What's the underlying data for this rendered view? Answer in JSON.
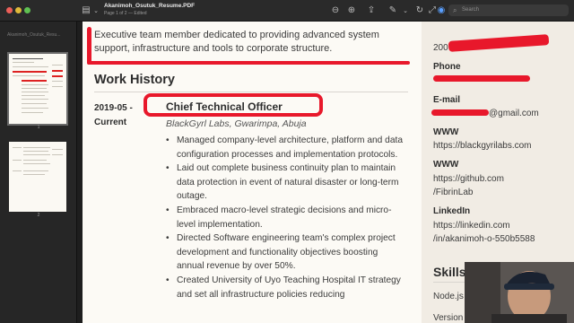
{
  "window": {
    "title": "Akanimoh_Osutuk_Resume.PDF",
    "subtitle": "Page 1 of 2 — Edited",
    "search_placeholder": "Search"
  },
  "sidebar": {
    "document_name": "Akanimoh_Osutuk_Resu...",
    "pages": [
      {
        "label": "1"
      },
      {
        "label": "2"
      }
    ]
  },
  "resume": {
    "summary_line1": "Executive team member dedicated to providing advanced system",
    "summary_line2": "support, infrastructure and tools to corporate structure.",
    "work_history_heading": "Work History",
    "job": {
      "dates_line1": "2019-05 -",
      "dates_line2": "Current",
      "title": "Chief Technical Officer",
      "company": "BlackGyrl Labs, Gwarimpa, Abuja",
      "bullets": [
        "Managed company-level architecture, platform and data configuration processes and implementation protocols.",
        "Laid out complete business continuity plan to maintain data protection in event of natural disaster or long-term outage.",
        "Embraced macro-level strategic decisions and micro-level implementation.",
        "Directed Software engineering team's complex project development and functionality objectives boosting annual revenue by over 50%.",
        "Created University of Uyo Teaching Hospital IT strategy and set all infrastructure policies reducing"
      ]
    }
  },
  "contact": {
    "year_fragment": "200",
    "phone_label": "Phone",
    "email_label": "E-mail",
    "email_suffix": "@gmail.com",
    "www_label_1": "WWW",
    "www_1": "https://blackgyrilabs.com",
    "www_label_2": "WWW",
    "www_2_line1": "https://github.com",
    "www_2_line2": "/FibrinLab",
    "linkedin_label": "LinkedIn",
    "linkedin_line1": "https://linkedin.com",
    "linkedin_line2": "/in/akanimoh-o-550b5588",
    "skills_heading": "Skills",
    "skill_1": "Node.js",
    "skill_2": "Version C"
  },
  "colors": {
    "annotation_red": "#e8182b",
    "page_background": "#fcfaf5",
    "sidebar_background": "#262626"
  },
  "icons": [
    "sidebar-toggle-icon",
    "chevron-down-icon",
    "zoom-out-icon",
    "zoom-in-icon",
    "share-icon",
    "markup-pen-icon",
    "rotate-icon",
    "expand-icon",
    "accessibility-icon",
    "search-icon"
  ]
}
